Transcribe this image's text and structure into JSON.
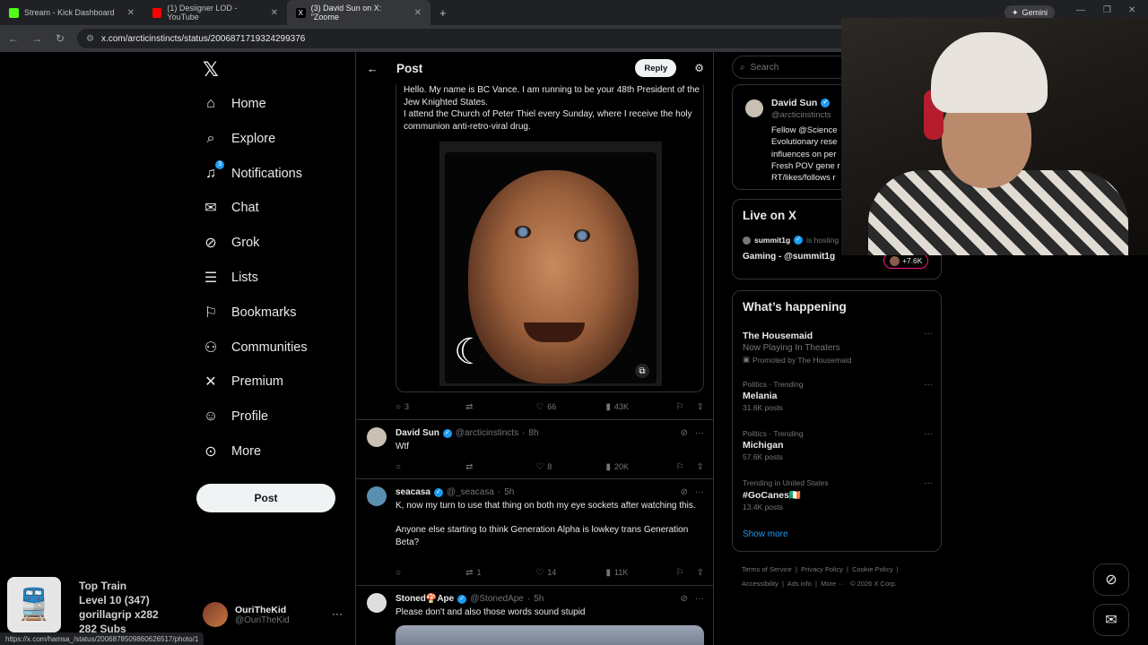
{
  "browser": {
    "tabs": [
      {
        "label": "Stream - Kick Dashboard",
        "color": "#53fc18"
      },
      {
        "label": "(1) Desiigner LOD - YouTube",
        "color": "#ff0000"
      },
      {
        "label": "(3) David Sun on X: \"Zoome",
        "color": "#ffffff"
      }
    ],
    "url": "x.com/arcticinstincts/status/2006871719324299376",
    "gemini_label": "Gemini",
    "status_url": "https://x.com/hamsa_/status/2006878509860626517/photo/1"
  },
  "nav": {
    "items": [
      {
        "label": "Home",
        "icon": "home-icon"
      },
      {
        "label": "Explore",
        "icon": "search-icon"
      },
      {
        "label": "Notifications",
        "icon": "bell-icon",
        "badge": "3"
      },
      {
        "label": "Chat",
        "icon": "mail-icon"
      },
      {
        "label": "Grok",
        "icon": "grok-icon"
      },
      {
        "label": "Lists",
        "icon": "list-icon"
      },
      {
        "label": "Bookmarks",
        "icon": "bookmark-icon"
      },
      {
        "label": "Communities",
        "icon": "people-icon"
      },
      {
        "label": "Premium",
        "icon": "x-icon"
      },
      {
        "label": "Profile",
        "icon": "person-icon"
      },
      {
        "label": "More",
        "icon": "more-circle-icon"
      }
    ],
    "post_label": "Post",
    "account": {
      "name": "OuriTheKid",
      "handle": "@OuriTheKid"
    }
  },
  "main": {
    "title": "Post",
    "reply_label": "Reply",
    "quote_text": "Hello. My name is BC Vance. I am running to be your 48th President of the Jew Knighted States.\nI attend the Church of Peter Thiel every Sunday, where I receive the holy communion anti-retro-viral drug.",
    "quote_stats": {
      "replies": "3",
      "reposts": "",
      "likes": "66",
      "views": "43K"
    },
    "replies": [
      {
        "name": "David Sun",
        "handle": "@arcticinstincts",
        "time": "8h",
        "text": "Wtf",
        "replies": "",
        "reposts": "",
        "likes": "8",
        "views": "20K"
      },
      {
        "name": "seacasa",
        "handle": "@_seacasa",
        "time": "5h",
        "text": "K, now my turn to use that thing on both my eye sockets after watching this.\n\nAnyone else starting to think Generation Alpha is lowkey trans Generation Beta?",
        "replies": "",
        "reposts": "1",
        "likes": "14",
        "views": "11K"
      },
      {
        "name": "Stoned🍄Ape",
        "handle": "@StonedApe",
        "time": "5h",
        "text": "Please don't and also those words sound stupid"
      }
    ]
  },
  "right": {
    "search_placeholder": "Search",
    "profile": {
      "name": "David Sun",
      "handle": "@arcticinstincts",
      "bio_lines": [
        "Fellow @Science",
        "Evolutionary rese",
        "influences on per",
        "Fresh POV gene r",
        "RT/likes/follows r"
      ]
    },
    "live": {
      "title": "Live on X",
      "host": "summit1g",
      "hosting": "is hosting",
      "space": "Gaming - @summit1g",
      "listeners": "+7.6K"
    },
    "happening": {
      "title": "What’s happening",
      "promo": {
        "title": "The Housemaid",
        "sub": "Now Playing In Theaters",
        "promoted": "Promoted by The Housemaid"
      },
      "trends": [
        {
          "meta": "Politics · Trending",
          "title": "Melania",
          "count": "31.6K posts"
        },
        {
          "meta": "Politics · Trending",
          "title": "Michigan",
          "count": "57.6K posts"
        },
        {
          "meta": "Trending in United States",
          "title": "#GoCanes🇮🇪",
          "count": "13.4K posts"
        }
      ],
      "show_more": "Show more"
    },
    "footer": [
      "Terms of Service",
      "Privacy Policy",
      "Cookie Policy",
      "Accessibility",
      "Ads info",
      "More ···",
      "© 2026 X Corp."
    ]
  },
  "stream_overlay": {
    "line1": "Top Train",
    "line2": "Level 10  (347)",
    "line3": "gorillagrip x282",
    "line4": "282 Subs"
  }
}
